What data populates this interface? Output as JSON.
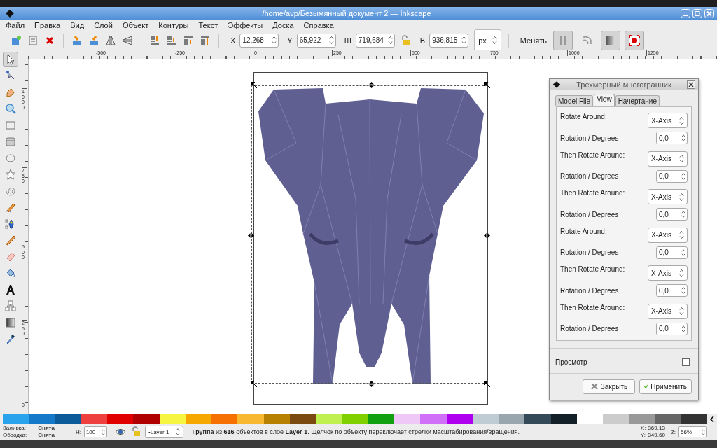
{
  "window": {
    "title": "/home/avp/Безымянный документ 2 — Inkscape"
  },
  "menu": [
    "Файл",
    "Правка",
    "Вид",
    "Слой",
    "Объект",
    "Контуры",
    "Текст",
    "Эффекты",
    "Доска",
    "Справка"
  ],
  "toolbar": {
    "fields": [
      {
        "label": "X",
        "value": "12,268"
      },
      {
        "label": "Y",
        "value": "65,922"
      },
      {
        "label": "Ш",
        "value": "719,684"
      },
      {
        "label": "В",
        "value": "936,815"
      }
    ],
    "unit": "px",
    "toggles_label": "Менять:",
    "toggles": [
      {
        "on": true
      },
      {
        "on": false
      },
      {
        "on": true
      },
      {
        "on": true
      }
    ]
  },
  "ruler_h": [
    "-500",
    "-250",
    "0",
    "250",
    "500",
    "750",
    "1000",
    "1250"
  ],
  "ruler_v": [
    "1000",
    "750",
    "500",
    "250",
    "0"
  ],
  "tools": [
    {
      "selected": true
    },
    {
      "selected": false
    },
    {
      "selected": false
    },
    {
      "selected": false
    },
    {
      "selected": false
    },
    {
      "selected": false
    },
    {
      "selected": false
    },
    {
      "selected": false
    },
    {
      "selected": false
    },
    {
      "selected": false
    },
    {
      "selected": false
    },
    {
      "selected": false
    },
    {
      "selected": false
    },
    {
      "selected": false
    },
    {
      "selected": false
    },
    {
      "selected": false
    },
    {
      "selected": false
    },
    {
      "selected": false
    }
  ],
  "dialog": {
    "title": "Трехмерный многогранник",
    "tabs": [
      {
        "label": "Model File",
        "selected": false
      },
      {
        "label": "View",
        "selected": true
      },
      {
        "label": "Начертание",
        "selected": false
      }
    ],
    "rows": [
      {
        "kind": "select",
        "label": "Rotate Around:",
        "value": "X-Axis"
      },
      {
        "kind": "number",
        "label": "Rotation / Degrees",
        "value": "0,0"
      },
      {
        "kind": "select",
        "label": "Then Rotate Around:",
        "value": "X-Axis"
      },
      {
        "kind": "number",
        "label": "Rotation / Degrees",
        "value": "0,0"
      },
      {
        "kind": "select",
        "label": "Then Rotate Around:",
        "value": "X-Axis"
      },
      {
        "kind": "number",
        "label": "Rotation / Degrees",
        "value": "0,0"
      },
      {
        "kind": "select",
        "label": "Rotate Around:",
        "value": "X-Axis"
      },
      {
        "kind": "number",
        "label": "Rotation / Degrees",
        "value": "0,0"
      },
      {
        "kind": "select",
        "label": "Then Rotate Around:",
        "value": "X-Axis"
      },
      {
        "kind": "number",
        "label": "Rotation / Degrees",
        "value": "0,0"
      },
      {
        "kind": "select",
        "label": "Then Rotate Around:",
        "value": "X-Axis"
      },
      {
        "kind": "number",
        "label": "Rotation / Degrees",
        "value": "0,0"
      }
    ],
    "preview": {
      "label": "Просмотр",
      "checked": false
    },
    "buttons": [
      {
        "kind": "close",
        "label": "Закрыть"
      },
      {
        "kind": "apply",
        "label": "Применить"
      }
    ]
  },
  "palette": [
    {
      "color": "#29a3ec"
    },
    {
      "color": "#1479c8"
    },
    {
      "color": "#0b5a9a"
    },
    {
      "color": "#ef4040"
    },
    {
      "color": "#e00000"
    },
    {
      "color": "#b00000"
    },
    {
      "color": "#f5f542"
    },
    {
      "color": "#f7a800"
    },
    {
      "color": "#f57000"
    },
    {
      "color": "#f8b830"
    },
    {
      "color": "#b88000"
    },
    {
      "color": "#7a4a10"
    },
    {
      "color": "#c0f050"
    },
    {
      "color": "#80d000"
    },
    {
      "color": "#10a010"
    },
    {
      "color": "#f0c8f8"
    },
    {
      "color": "#d070f8"
    },
    {
      "color": "#b000f0"
    },
    {
      "color": "#c0ccd4"
    },
    {
      "color": "#9aa6ae"
    },
    {
      "color": "#344a58"
    },
    {
      "color": "#142028"
    },
    {
      "color": "#ffffff"
    },
    {
      "color": "#cccccc"
    },
    {
      "color": "#999999"
    },
    {
      "color": "#666666"
    },
    {
      "color": "#333333"
    }
  ],
  "status_bar": {
    "fill_label": "Заливка:",
    "fill_value": "Снята",
    "stroke_label": "Обводка:",
    "stroke_value": "Снята",
    "opacity_label": "Н:",
    "opacity_value": "100",
    "layer": "•Layer 1",
    "message": "**Группа** из **616** объектов в слое **Layer 1**. Щелчок по объекту переключает стрелки масштабирования/вращения.",
    "x_label": "X:",
    "x_value": "369,13",
    "y_label": "Y:",
    "y_value": "349,60",
    "zoom_label": "Z:",
    "zoom_value": "56%"
  }
}
